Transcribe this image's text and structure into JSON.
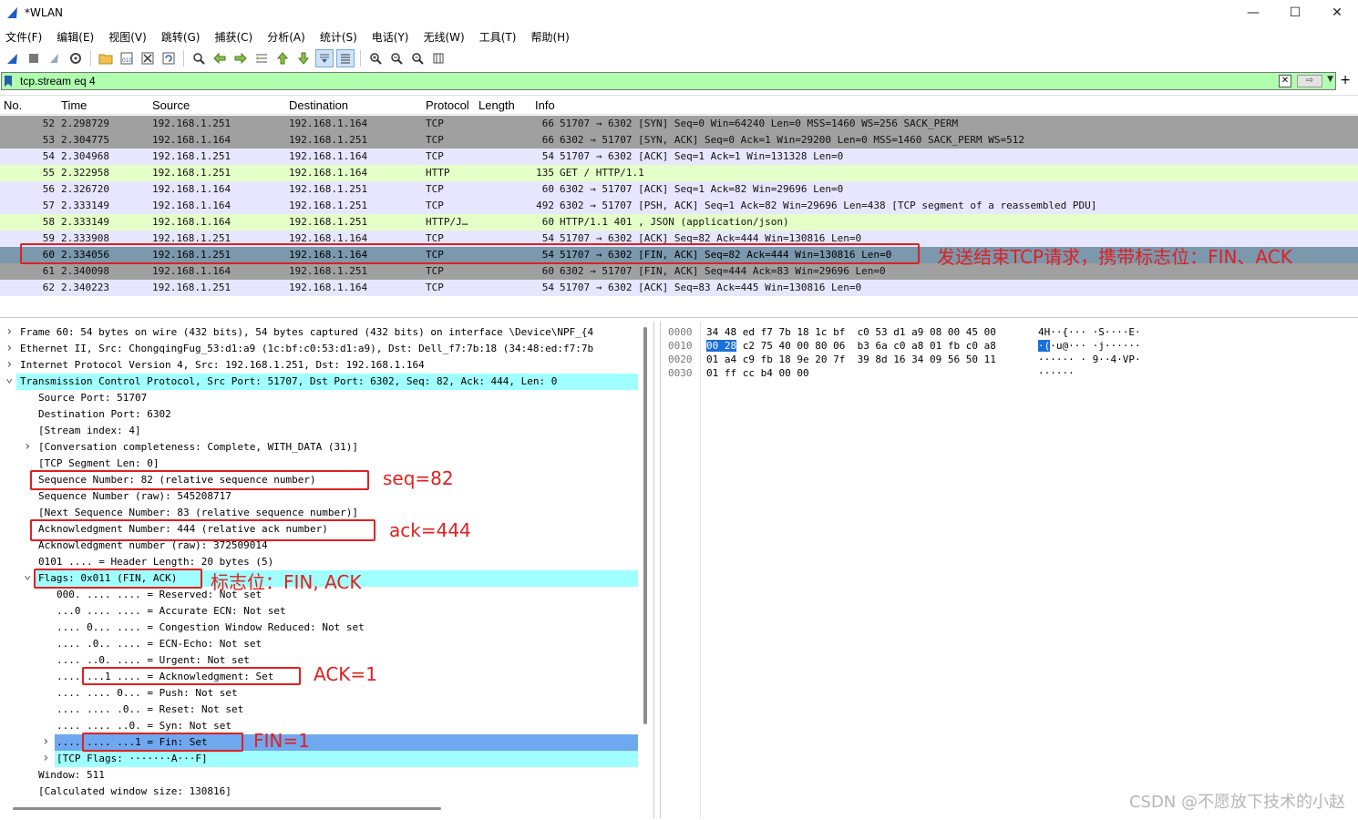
{
  "window": {
    "title": "*WLAN",
    "controls": [
      "—",
      "☐",
      "✕"
    ]
  },
  "menu": [
    "文件(F)",
    "编辑(E)",
    "视图(V)",
    "跳转(G)",
    "捕获(C)",
    "分析(A)",
    "统计(S)",
    "电话(Y)",
    "无线(W)",
    "工具(T)",
    "帮助(H)"
  ],
  "toolbar_icons": [
    "shark-fin-start-icon",
    "stop-icon",
    "restart-icon",
    "options-gear-icon",
    "open-folder-icon",
    "save-file-icon",
    "close-file-icon",
    "reload-icon",
    "find-packet-icon",
    "go-back-icon",
    "go-forward-icon",
    "go-to-packet-icon",
    "go-first-icon",
    "go-last-icon",
    "autoscroll-icon",
    "colorize-icon",
    "zoom-in-icon",
    "zoom-out-icon",
    "zoom-normal-icon",
    "resize-columns-icon"
  ],
  "filter": {
    "value": "tcp.stream eq 4",
    "add_label": "+"
  },
  "columns": {
    "no": "No.",
    "time": "Time",
    "source": "Source",
    "destination": "Destination",
    "protocol": "Protocol",
    "length": "Length",
    "info": "Info"
  },
  "packets": [
    {
      "no": "52",
      "time": "2.298729",
      "src": "192.168.1.251",
      "dst": "192.168.1.164",
      "proto": "TCP",
      "len": "66",
      "info": "51707 → 6302 [SYN] Seq=0 Win=64240 Len=0 MSS=1460 WS=256 SACK_PERM",
      "bg": "#a0a0a0",
      "fg": "#121212"
    },
    {
      "no": "53",
      "time": "2.304775",
      "src": "192.168.1.164",
      "dst": "192.168.1.251",
      "proto": "TCP",
      "len": "66",
      "info": "6302 → 51707 [SYN, ACK] Seq=0 Ack=1 Win=29200 Len=0 MSS=1460 SACK_PERM WS=512",
      "bg": "#a0a0a0",
      "fg": "#121212"
    },
    {
      "no": "54",
      "time": "2.304968",
      "src": "192.168.1.251",
      "dst": "192.168.1.164",
      "proto": "TCP",
      "len": "54",
      "info": "51707 → 6302 [ACK] Seq=1 Ack=1 Win=131328 Len=0",
      "bg": "#e7e6ff",
      "fg": "#121212"
    },
    {
      "no": "55",
      "time": "2.322958",
      "src": "192.168.1.251",
      "dst": "192.168.1.164",
      "proto": "HTTP",
      "len": "135",
      "info": "GET / HTTP/1.1",
      "bg": "#e4ffc7",
      "fg": "#121212"
    },
    {
      "no": "56",
      "time": "2.326720",
      "src": "192.168.1.164",
      "dst": "192.168.1.251",
      "proto": "TCP",
      "len": "60",
      "info": "6302 → 51707 [ACK] Seq=1 Ack=82 Win=29696 Len=0",
      "bg": "#e7e6ff",
      "fg": "#121212"
    },
    {
      "no": "57",
      "time": "2.333149",
      "src": "192.168.1.164",
      "dst": "192.168.1.251",
      "proto": "TCP",
      "len": "492",
      "info": "6302 → 51707 [PSH, ACK] Seq=1 Ack=82 Win=29696 Len=438 [TCP segment of a reassembled PDU]",
      "bg": "#e7e6ff",
      "fg": "#121212"
    },
    {
      "no": "58",
      "time": "2.333149",
      "src": "192.168.1.164",
      "dst": "192.168.1.251",
      "proto": "HTTP/J…",
      "len": "60",
      "info": "HTTP/1.1 401  , JSON (application/json)",
      "bg": "#e4ffc7",
      "fg": "#121212"
    },
    {
      "no": "59",
      "time": "2.333908",
      "src": "192.168.1.251",
      "dst": "192.168.1.164",
      "proto": "TCP",
      "len": "54",
      "info": "51707 → 6302 [ACK] Seq=82 Ack=444 Win=130816 Len=0",
      "bg": "#e7e6ff",
      "fg": "#121212"
    },
    {
      "no": "60",
      "time": "2.334056",
      "src": "192.168.1.251",
      "dst": "192.168.1.164",
      "proto": "TCP",
      "len": "54",
      "info": "51707 → 6302 [FIN, ACK] Seq=82 Ack=444 Win=130816 Len=0",
      "bg": "#7b98ad",
      "fg": "#000000"
    },
    {
      "no": "61",
      "time": "2.340098",
      "src": "192.168.1.164",
      "dst": "192.168.1.251",
      "proto": "TCP",
      "len": "60",
      "info": "6302 → 51707 [FIN, ACK] Seq=444 Ack=83 Win=29696 Len=0",
      "bg": "#a0a0a0",
      "fg": "#121212"
    },
    {
      "no": "62",
      "time": "2.340223",
      "src": "192.168.1.251",
      "dst": "192.168.1.164",
      "proto": "TCP",
      "len": "54",
      "info": "51707 → 6302 [ACK] Seq=83 Ack=445 Win=130816 Len=0",
      "bg": "#e7e6ff",
      "fg": "#121212"
    }
  ],
  "details": [
    {
      "indent": 0,
      "arrow": ">",
      "text": "Frame 60: 54 bytes on wire (432 bits), 54 bytes captured (432 bits) on interface \\Device\\NPF_{4",
      "bg": ""
    },
    {
      "indent": 0,
      "arrow": ">",
      "text": "Ethernet II, Src: ChongqingFug_53:d1:a9 (1c:bf:c0:53:d1:a9), Dst: Dell_f7:7b:18 (34:48:ed:f7:7b",
      "bg": ""
    },
    {
      "indent": 0,
      "arrow": ">",
      "text": "Internet Protocol Version 4, Src: 192.168.1.251, Dst: 192.168.1.164",
      "bg": ""
    },
    {
      "indent": 0,
      "arrow": "v",
      "text": "Transmission Control Protocol, Src Port: 51707, Dst Port: 6302, Seq: 82, Ack: 444, Len: 0",
      "bg": "#a0ffff"
    },
    {
      "indent": 1,
      "arrow": "",
      "text": "Source Port: 51707",
      "bg": ""
    },
    {
      "indent": 1,
      "arrow": "",
      "text": "Destination Port: 6302",
      "bg": ""
    },
    {
      "indent": 1,
      "arrow": "",
      "text": "[Stream index: 4]",
      "bg": ""
    },
    {
      "indent": 1,
      "arrow": ">",
      "text": "[Conversation completeness: Complete, WITH_DATA (31)]",
      "bg": ""
    },
    {
      "indent": 1,
      "arrow": "",
      "text": "[TCP Segment Len: 0]",
      "bg": ""
    },
    {
      "indent": 1,
      "arrow": "",
      "text": "Sequence Number: 82    (relative sequence number)",
      "bg": ""
    },
    {
      "indent": 1,
      "arrow": "",
      "text": "Sequence Number (raw): 545208717",
      "bg": ""
    },
    {
      "indent": 1,
      "arrow": "",
      "text": "[Next Sequence Number: 83    (relative sequence number)]",
      "bg": ""
    },
    {
      "indent": 1,
      "arrow": "",
      "text": "Acknowledgment Number: 444    (relative ack number)",
      "bg": ""
    },
    {
      "indent": 1,
      "arrow": "",
      "text": "Acknowledgment number (raw): 372509014",
      "bg": ""
    },
    {
      "indent": 1,
      "arrow": "",
      "text": "0101 .... = Header Length: 20 bytes (5)",
      "bg": ""
    },
    {
      "indent": 1,
      "arrow": "v",
      "text": "Flags: 0x011 (FIN, ACK)",
      "bg": "#a0ffff"
    },
    {
      "indent": 2,
      "arrow": "",
      "text": "000. .... .... = Reserved: Not set",
      "bg": ""
    },
    {
      "indent": 2,
      "arrow": "",
      "text": "...0 .... .... = Accurate ECN: Not set",
      "bg": ""
    },
    {
      "indent": 2,
      "arrow": "",
      "text": ".... 0... .... = Congestion Window Reduced: Not set",
      "bg": ""
    },
    {
      "indent": 2,
      "arrow": "",
      "text": ".... .0.. .... = ECN-Echo: Not set",
      "bg": ""
    },
    {
      "indent": 2,
      "arrow": "",
      "text": ".... ..0. .... = Urgent: Not set",
      "bg": ""
    },
    {
      "indent": 2,
      "arrow": "",
      "text": ".... ...1 .... = Acknowledgment: Set",
      "bg": ""
    },
    {
      "indent": 2,
      "arrow": "",
      "text": ".... .... 0... = Push: Not set",
      "bg": ""
    },
    {
      "indent": 2,
      "arrow": "",
      "text": ".... .... .0.. = Reset: Not set",
      "bg": ""
    },
    {
      "indent": 2,
      "arrow": "",
      "text": ".... .... ..0. = Syn: Not set",
      "bg": ""
    },
    {
      "indent": 2,
      "arrow": ">",
      "text": ".... .... ...1 = Fin: Set",
      "bg": "#6fa8ee"
    },
    {
      "indent": 2,
      "arrow": ">",
      "text": "[TCP Flags: ·······A···F]",
      "bg": "#a0ffff"
    },
    {
      "indent": 1,
      "arrow": "",
      "text": "Window: 511",
      "bg": ""
    },
    {
      "indent": 1,
      "arrow": "",
      "text": "[Calculated window size: 130816]",
      "bg": ""
    }
  ],
  "bytes": [
    {
      "offset": "0000",
      "hex_pre": "",
      "hex_hl": "",
      "hex_post": "34 48 ed f7 7b 18 1c bf  c0 53 d1 a9 08 00 45 00",
      "ascii_pre": "",
      "ascii_hl": "",
      "ascii_post": "4H··{··· ·S····E·"
    },
    {
      "offset": "0010",
      "hex_pre": "",
      "hex_hl": "00 28",
      "hex_post": " c2 75 40 00 80 06  b3 6a c0 a8 01 fb c0 a8",
      "ascii_pre": "",
      "ascii_hl": "·(",
      "ascii_post": "·u@··· ·j······"
    },
    {
      "offset": "0020",
      "hex_pre": "",
      "hex_hl": "",
      "hex_post": "01 a4 c9 fb 18 9e 20 7f  39 8d 16 34 09 56 50 11",
      "ascii_pre": "",
      "ascii_hl": "",
      "ascii_post": "······ · 9··4·VP·"
    },
    {
      "offset": "0030",
      "hex_pre": "",
      "hex_hl": "",
      "hex_post": "01 ff cc b4 00 00",
      "ascii_pre": "",
      "ascii_hl": "",
      "ascii_post": "······"
    }
  ],
  "annotations": {
    "fin_request": "发送结束TCP请求，携带标志位：FIN、ACK",
    "seq": "seq=82",
    "ack": "ack=444",
    "flags": "标志位：FIN, ACK",
    "ack_flag": "ACK=1",
    "fin_flag": "FIN=1",
    "color": "#e02020"
  },
  "watermark": "CSDN @不愿放下技术的小赵"
}
